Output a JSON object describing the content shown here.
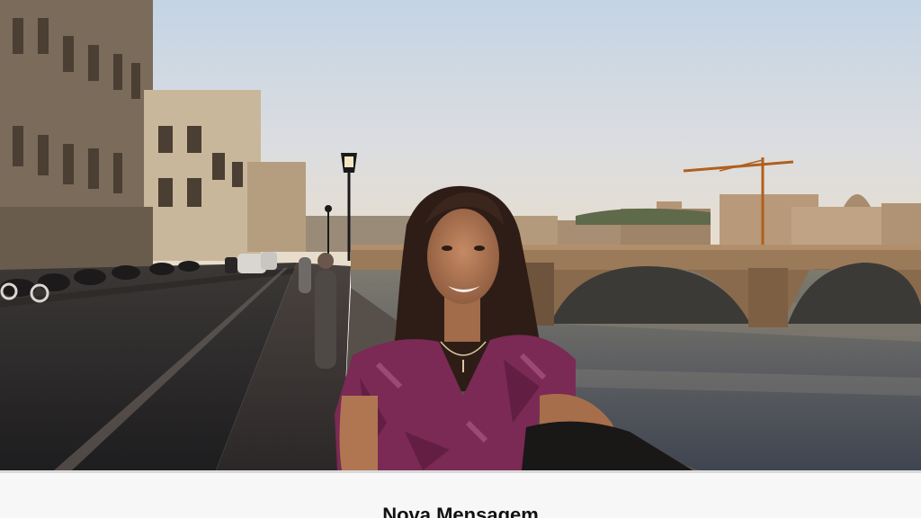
{
  "photo": {
    "description_icon": "photo-image"
  },
  "compose_sheet": {
    "title": "Nova Mensagem"
  },
  "colors": {
    "sheet_background": "#f7f7f7",
    "sheet_border": "#d9d9d9",
    "title_text": "#111111"
  }
}
